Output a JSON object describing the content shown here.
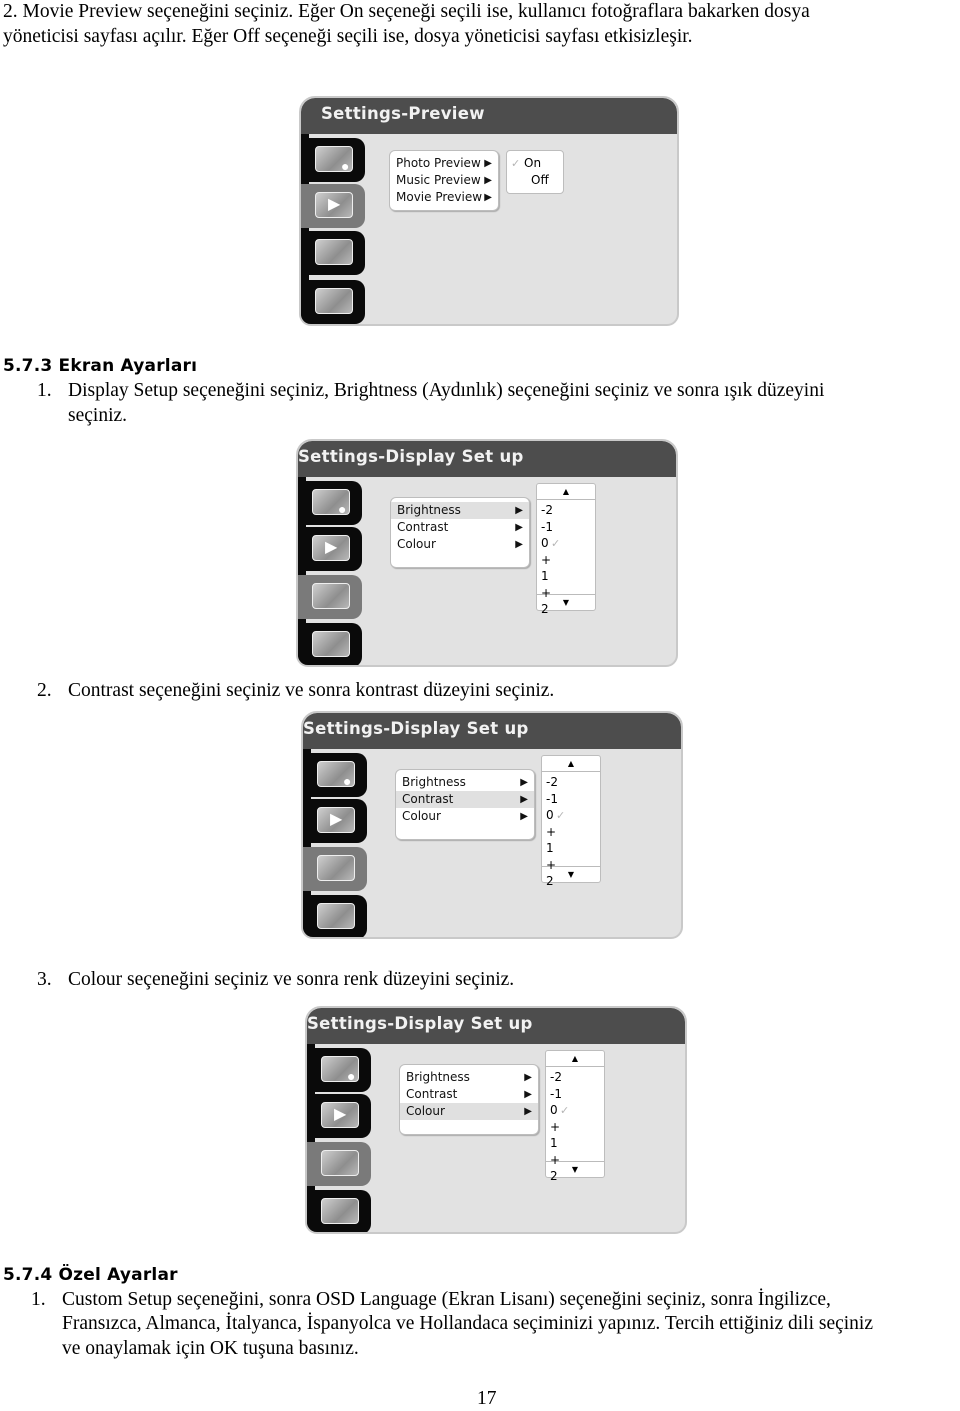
{
  "intro": {
    "line1": "2. Movie Preview seçeneğini seçiniz. Eğer On seçeneği seçili ise, kullanıcı fotoğraflara bakarken dosya",
    "line2": "yöneticisi sayfası açılır. Eğer Off seçeneği seçili ise, dosya yöneticisi sayfası etkisizleşir."
  },
  "preview_panel": {
    "title": "Settings-Preview",
    "tabs": [
      "photo-icon",
      "movie-icon",
      "slideshow-icon",
      "custom-icon"
    ],
    "selected_tab": 1,
    "menu": [
      {
        "label": "Photo Preview",
        "arrow": "▶"
      },
      {
        "label": "Music Preview",
        "arrow": "▶"
      },
      {
        "label": "Movie Preview",
        "arrow": "▶"
      }
    ],
    "options": [
      {
        "label": "On",
        "check": "✓",
        "checked": true
      },
      {
        "label": "Off",
        "checked": false
      }
    ]
  },
  "section_573": {
    "heading": "5.7.3 Ekran Ayarları",
    "step1_num": "1.",
    "step1_line1": "Display Setup seçeneğini seçiniz, Brightness (Aydınlık) seçeneğini seçiniz ve sonra ışık düzeyini",
    "step1_line2": "seçiniz.",
    "step2_num": "2.",
    "step2": "Contrast seçeneğini seçiniz ve sonra kontrast düzeyini seçiniz.",
    "step3_num": "3.",
    "step3": "Colour seçeneğini seçiniz ve sonra renk düzeyini seçiniz."
  },
  "display_panel": {
    "title": "Settings-Display Set up",
    "menu": [
      {
        "label": "Brightness",
        "arrow": "▶"
      },
      {
        "label": "Contrast",
        "arrow": "▶"
      },
      {
        "label": "Colour",
        "arrow": "▶"
      }
    ],
    "levels": [
      "-2",
      "-1",
      "0",
      "+",
      "1",
      "+",
      "2"
    ],
    "selected_level": "0",
    "check": "✓",
    "scroll_up": "▲",
    "scroll_down": "▼",
    "selected_rows": [
      "Brightness",
      "Contrast",
      "Colour"
    ]
  },
  "section_574": {
    "heading": "5.7.4 Özel Ayarlar",
    "step1_num": "1.",
    "line1": "Custom Setup seçeneğini, sonra OSD Language (Ekran Lisanı) seçeneğini seçiniz, sonra İngilizce,",
    "line2": "Fransızca, Almanca, İtalyanca, İspanyolca ve Hollandaca seçiminizi yapınız. Tercih ettiğiniz dili seçiniz",
    "line3": "ve onaylamak için OK tuşuna basınız."
  },
  "page_number": "17"
}
